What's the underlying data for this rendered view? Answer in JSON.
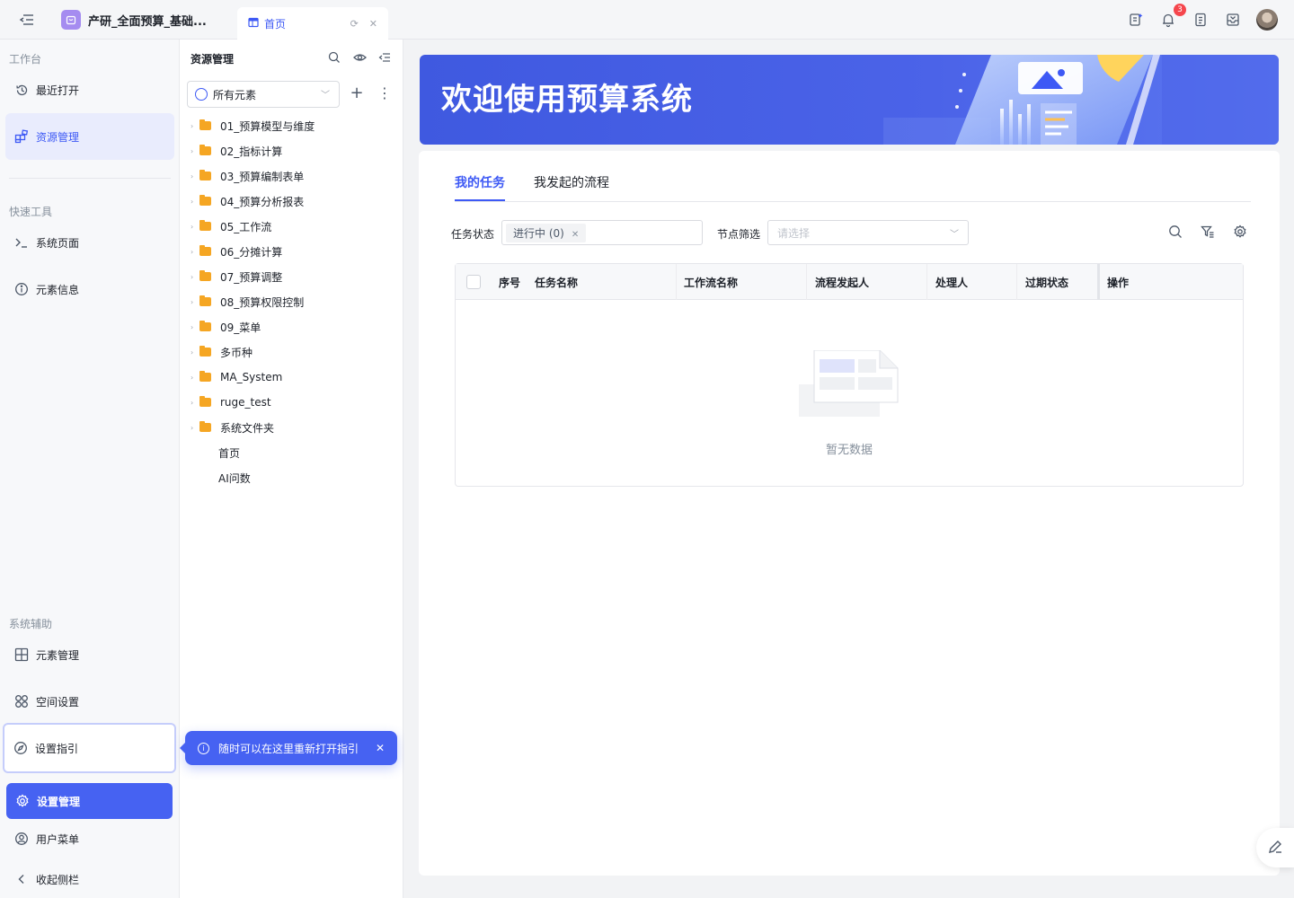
{
  "topbar": {
    "app_name": "产研_全面预算_基础...",
    "home_tab_label": "首页",
    "notification_count": "3",
    "icons": [
      "menu-collapse-icon",
      "task-sparkle-icon",
      "bell-icon",
      "document-icon",
      "inbox-icon",
      "avatar"
    ]
  },
  "sidebar": {
    "section_workspace": "工作台",
    "recent": "最近打开",
    "resources": "资源管理",
    "section_tools": "快速工具",
    "system_pages": "系统页面",
    "element_info": "元素信息",
    "section_assist": "系统辅助",
    "element_mgmt": "元素管理",
    "space_settings": "空间设置",
    "setup_guide": "设置指引",
    "settings_mgmt": "设置管理",
    "user_menu": "用户菜单",
    "collapse": "收起侧栏"
  },
  "tree": {
    "title": "资源管理",
    "filter_value": "所有元素",
    "items": [
      {
        "label": "01_预算模型与维度",
        "type": "folder"
      },
      {
        "label": "02_指标计算",
        "type": "folder"
      },
      {
        "label": "03_预算编制表单",
        "type": "folder"
      },
      {
        "label": "04_预算分析报表",
        "type": "folder"
      },
      {
        "label": "05_工作流",
        "type": "folder"
      },
      {
        "label": "06_分摊计算",
        "type": "folder"
      },
      {
        "label": "07_预算调整",
        "type": "folder"
      },
      {
        "label": "08_预算权限控制",
        "type": "folder"
      },
      {
        "label": "09_菜单",
        "type": "folder"
      },
      {
        "label": "多币种",
        "type": "folder"
      },
      {
        "label": "MA_System",
        "type": "folder"
      },
      {
        "label": "ruge_test",
        "type": "folder"
      },
      {
        "label": "系统文件夹",
        "type": "folder"
      },
      {
        "label": "首页",
        "type": "leaf"
      },
      {
        "label": "AI问数",
        "type": "leaf"
      }
    ]
  },
  "toast": {
    "message": "随时可以在这里重新打开指引"
  },
  "banner": {
    "title": "欢迎使用预算系统"
  },
  "tasks": {
    "tab_mine": "我的任务",
    "tab_started": "我发起的流程",
    "status_label": "任务状态",
    "status_chip": "进行中 (0)",
    "node_label": "节点筛选",
    "node_placeholder": "请选择",
    "columns": [
      "序号",
      "任务名称",
      "工作流名称",
      "流程发起人",
      "处理人",
      "过期状态",
      "操作"
    ],
    "empty_text": "暂无数据"
  }
}
